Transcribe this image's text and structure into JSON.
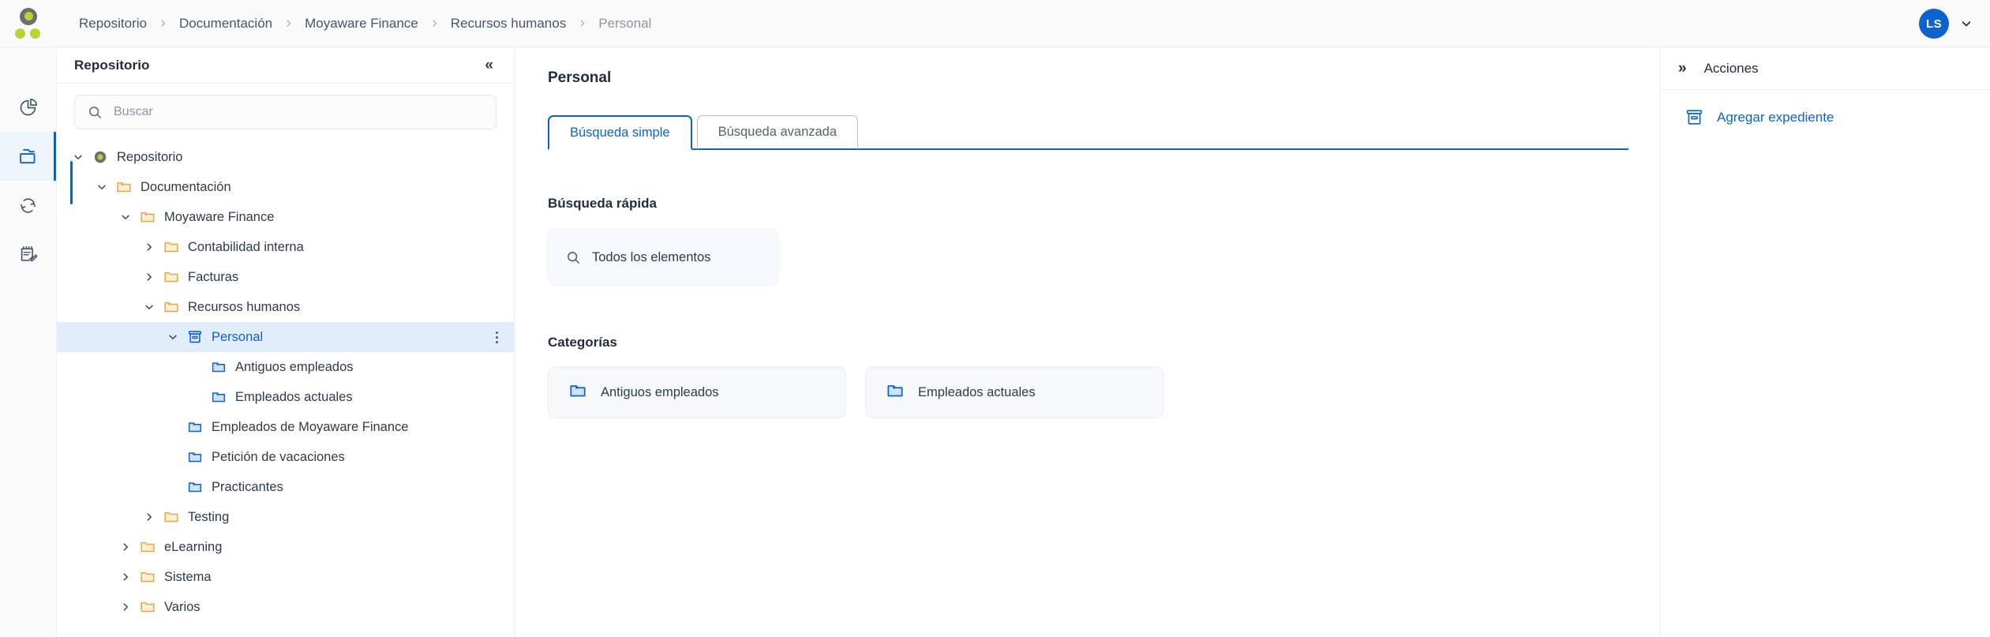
{
  "brand": {
    "logo_name": "moyaware-logo",
    "accent_green": "#b7d433",
    "accent_blue": "#0b63ce"
  },
  "topbar": {
    "breadcrumb": [
      {
        "label": "Repositorio",
        "current": false
      },
      {
        "label": "Documentación",
        "current": false
      },
      {
        "label": "Moyaware Finance",
        "current": false
      },
      {
        "label": "Recursos humanos",
        "current": false
      },
      {
        "label": "Personal",
        "current": true
      }
    ],
    "avatar_initials": "LS",
    "avatar_color": "#0b63ce"
  },
  "rail": {
    "items": [
      {
        "icon": "pie-chart-icon",
        "name": "rail-item-dashboard",
        "active": false
      },
      {
        "icon": "folder-icon",
        "name": "rail-item-repository",
        "active": true
      },
      {
        "icon": "refresh-icon",
        "name": "rail-item-workflow",
        "active": false
      },
      {
        "icon": "notepad-edit-icon",
        "name": "rail-item-tasks",
        "active": false
      }
    ]
  },
  "sidebar": {
    "title": "Repositorio",
    "collapse_label": "«",
    "search": {
      "placeholder": "Buscar",
      "value": ""
    },
    "tree": [
      {
        "label": "Repositorio",
        "depth": 0,
        "icon": "repository-root-icon",
        "twisty": "down",
        "selected": false
      },
      {
        "label": "Documentación",
        "depth": 1,
        "icon": "folder-open-icon",
        "twisty": "down",
        "selected": false
      },
      {
        "label": "Moyaware Finance",
        "depth": 2,
        "icon": "folder-open-icon",
        "twisty": "down",
        "selected": false
      },
      {
        "label": "Contabilidad interna",
        "depth": 3,
        "icon": "folder-icon",
        "twisty": "right",
        "selected": false
      },
      {
        "label": "Facturas",
        "depth": 3,
        "icon": "folder-icon",
        "twisty": "right",
        "selected": false
      },
      {
        "label": "Recursos humanos",
        "depth": 3,
        "icon": "folder-open-icon",
        "twisty": "down",
        "selected": false
      },
      {
        "label": "Personal",
        "depth": 4,
        "icon": "dossier-icon",
        "twisty": "down",
        "selected": true
      },
      {
        "label": "Antiguos empleados",
        "depth": 5,
        "icon": "category-folder-icon",
        "twisty": "none",
        "selected": false
      },
      {
        "label": "Empleados actuales",
        "depth": 5,
        "icon": "category-folder-icon",
        "twisty": "none",
        "selected": false
      },
      {
        "label": "Empleados de Moyaware Finance",
        "depth": 4,
        "icon": "category-folder-icon",
        "twisty": "none",
        "selected": false
      },
      {
        "label": "Petición de vacaciones",
        "depth": 4,
        "icon": "category-folder-icon",
        "twisty": "none",
        "selected": false
      },
      {
        "label": "Practicantes",
        "depth": 4,
        "icon": "category-folder-icon",
        "twisty": "none",
        "selected": false
      },
      {
        "label": "Testing",
        "depth": 3,
        "icon": "folder-icon",
        "twisty": "right",
        "selected": false
      },
      {
        "label": "eLearning",
        "depth": 2,
        "icon": "folder-icon",
        "twisty": "right",
        "selected": false
      },
      {
        "label": "Sistema",
        "depth": 2,
        "icon": "folder-icon",
        "twisty": "right",
        "selected": false
      },
      {
        "label": "Varios",
        "depth": 2,
        "icon": "folder-icon",
        "twisty": "right",
        "selected": false
      }
    ]
  },
  "main": {
    "page_title": "Personal",
    "tabs": [
      {
        "label": "Búsqueda simple",
        "active": true
      },
      {
        "label": "Búsqueda avanzada",
        "active": false
      }
    ],
    "quick_search": {
      "heading": "Búsqueda rápida",
      "card_label": "Todos los elementos"
    },
    "categories": {
      "heading": "Categorías",
      "items": [
        {
          "label": "Antiguos empleados"
        },
        {
          "label": "Empleados actuales"
        }
      ]
    }
  },
  "actions": {
    "expand_label": "»",
    "title": "Acciones",
    "items": [
      {
        "label": "Agregar expediente",
        "icon": "dossier-add-icon"
      }
    ]
  }
}
